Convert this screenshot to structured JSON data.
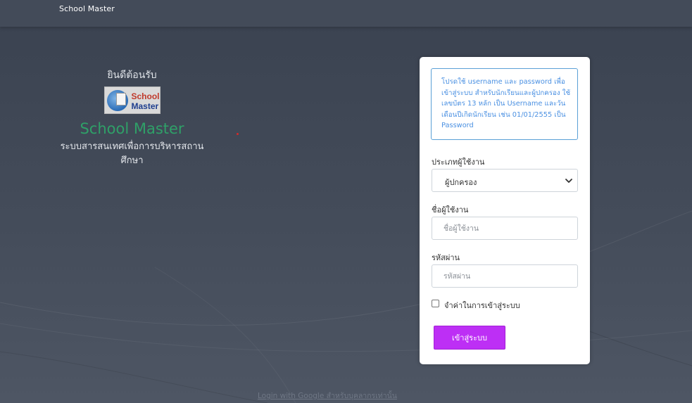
{
  "navbar": {
    "brand": "School Master"
  },
  "welcome": {
    "title": "ยินดีต้อนรับ",
    "logo_line1": "School",
    "logo_line2": "Master",
    "app_name": "School Master",
    "description_line1": "ระบบสารสนเทศเพื่อการบริหารสถาน",
    "description_line2": "ศึกษา"
  },
  "login": {
    "info_text": "โปรดใช้ username และ password เพื่อเข้าสู่ระบบ สำหรับนักเรียนและผู้ปกครอง ใช้เลขบัตร 13 หลัก เป็น Username และวันเดือนปีเกิดนักเรียน เช่น 01/01/2555 เป็น Password",
    "user_type_label": "ประเภทผู้ใช้งาน",
    "user_type_value": "ผู้ปกครอง",
    "username_label": "ชื่อผู้ใช้งาน",
    "username_placeholder": "ชื่อผู้ใช้งาน",
    "password_label": "รหัสผ่าน",
    "password_placeholder": "รหัสผ่าน",
    "remember_label": "จำค่าในการเข้าสู่ระบบ",
    "submit_label": "เข้าสู่ระบบ"
  },
  "footer": {
    "google_login": "Login with Google สำหรับบุคลากรเท่านั้น"
  },
  "colors": {
    "accent_button": "#bd2ff5",
    "app_name_green": "#2fa068",
    "info_blue": "#4a90e2"
  }
}
